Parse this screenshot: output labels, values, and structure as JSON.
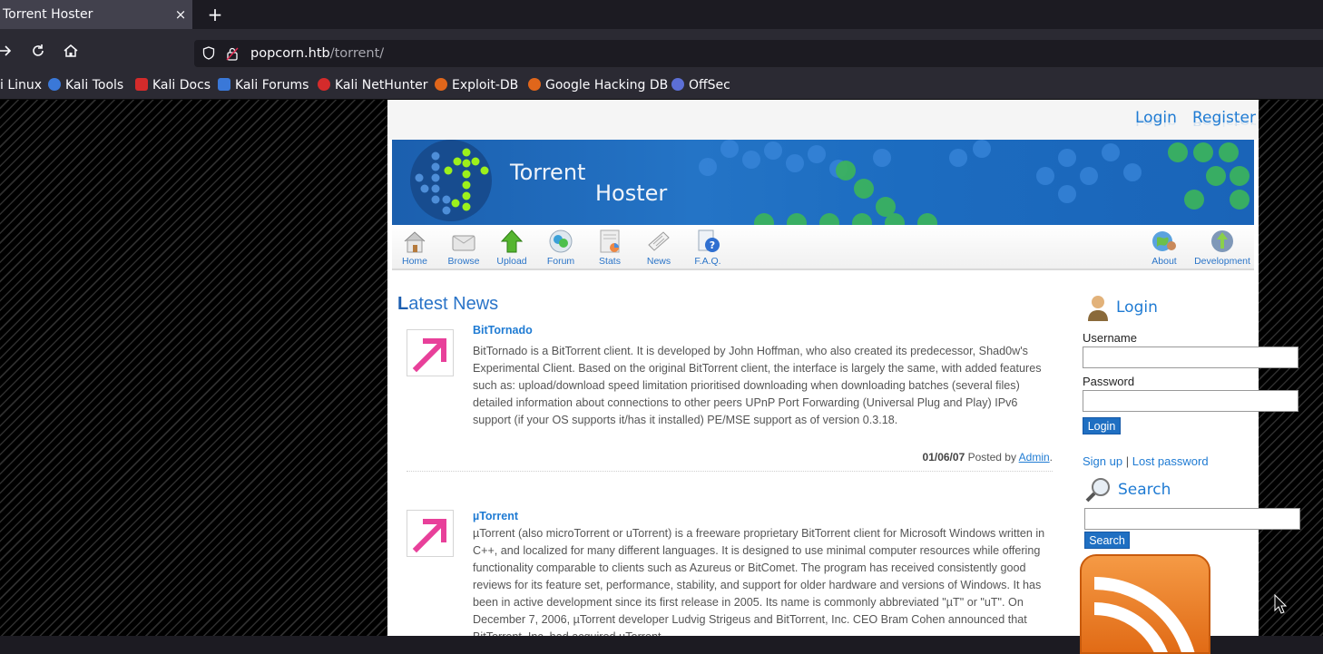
{
  "browser": {
    "tab_title": "Torrent Hoster",
    "tab_close": "×",
    "new_tab": "+",
    "url_host": "popcorn.htb",
    "url_path": "/torrent/",
    "bookmarks": [
      {
        "label": "i Linux",
        "color": ""
      },
      {
        "label": "Kali Tools",
        "color": "#3a78d8"
      },
      {
        "label": "Kali Docs",
        "color": "#d42b2b"
      },
      {
        "label": "Kali Forums",
        "color": "#3a78d8"
      },
      {
        "label": "Kali NetHunter",
        "color": "#d42b2b"
      },
      {
        "label": "Exploit-DB",
        "color": "#e0661b"
      },
      {
        "label": "Google Hacking DB",
        "color": "#e0661b"
      },
      {
        "label": "OffSec",
        "color": "#5c6fd6"
      }
    ]
  },
  "site": {
    "top_links": {
      "login": "Login",
      "register": "Register"
    },
    "banner": {
      "word1": "Torrent",
      "word2": "Hoster"
    },
    "menu_left": [
      {
        "label": "Home",
        "icon": "home-icon"
      },
      {
        "label": "Browse",
        "icon": "browse-icon"
      },
      {
        "label": "Upload",
        "icon": "upload-icon"
      },
      {
        "label": "Forum",
        "icon": "forum-icon"
      },
      {
        "label": "Stats",
        "icon": "stats-icon"
      },
      {
        "label": "News",
        "icon": "news-icon"
      },
      {
        "label": "F.A.Q.",
        "icon": "faq-icon"
      }
    ],
    "menu_right": [
      {
        "label": "About",
        "icon": "about-icon"
      },
      {
        "label": "Development",
        "icon": "development-icon"
      }
    ],
    "main_title_first": "L",
    "main_title_rest": "atest News",
    "news": [
      {
        "title": "BitTornado",
        "body": "BitTornado is a BitTorrent client. It is developed by John Hoffman, who also created its predecessor, Shad0w's Experimental Client. Based on the original BitTorrent client, the interface is largely the same, with added features such as: upload/download speed limitation prioritised downloading when downloading batches (several files) detailed information about connections to other peers UPnP Port Forwarding (Universal Plug and Play) IPv6 support (if your OS supports it/has it installed) PE/MSE support as of version 0.3.18.",
        "date": "01/06/07",
        "posted_by": "Posted by",
        "author": "Admin",
        "period": "."
      },
      {
        "title": "µTorrent",
        "body": "µTorrent (also microTorrent or uTorrent) is a freeware proprietary BitTorrent client for Microsoft Windows written in C++, and localized for many different languages. It is designed to use minimal computer resources while offering functionality comparable to clients such as Azureus or BitComet. The program has received consistently good reviews for its feature set, performance, stability, and support for older hardware and versions of Windows. It has been in active development since its first release in 2005. Its name is commonly abbreviated \"µT\" or \"uT\". On December 7, 2006, µTorrent developer Ludvig Strigeus and BitTorrent, Inc. CEO Bram Cohen announced that BitTorrent, Inc. had acquired µTorrent."
      }
    ],
    "sidebar": {
      "login_heading": "Login",
      "username_label": "Username",
      "password_label": "Password",
      "login_button": "Login",
      "signup_link": "Sign up",
      "links_sep": "|",
      "lost_password_link": "Lost password",
      "search_heading": "Search",
      "search_button": "Search"
    }
  },
  "colors": {
    "accent": "#1f7bd3",
    "button": "#1f6fc2",
    "rss": "#e16b16"
  }
}
